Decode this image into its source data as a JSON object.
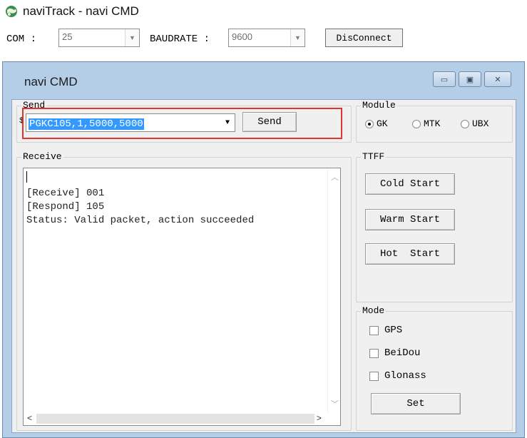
{
  "app": {
    "title": "naviTrack - navi CMD"
  },
  "toolbar": {
    "com_label": "COM :",
    "com_value": "25",
    "baud_label": "BAUDRATE :",
    "baud_value": "9600",
    "connect_button": "DisConnect"
  },
  "child_window": {
    "title": "navi CMD",
    "minimize_glyph": "▭",
    "maximize_glyph": "▣",
    "close_glyph": "✕"
  },
  "send": {
    "legend": "Send",
    "prefix": "$",
    "command": "PGKC105,1,5000,5000",
    "button": "Send"
  },
  "module": {
    "legend": "Module",
    "options": [
      {
        "label": "GK",
        "selected": true
      },
      {
        "label": "MTK",
        "selected": false
      },
      {
        "label": "UBX",
        "selected": false
      }
    ]
  },
  "receive": {
    "legend": "Receive",
    "lines": "\n[Receive] 001\n[Respond] 105\nStatus: Valid packet, action succeeded"
  },
  "ttff": {
    "legend": "TTFF",
    "cold": "Cold Start",
    "warm": "Warm Start",
    "hot": "Hot  Start"
  },
  "mode": {
    "legend": "Mode",
    "options": [
      {
        "label": "GPS",
        "checked": false
      },
      {
        "label": "BeiDou",
        "checked": false
      },
      {
        "label": "Glonass",
        "checked": false
      }
    ],
    "set_button": "Set"
  },
  "colors": {
    "highlight": "#e23232",
    "selection": "#3399ff",
    "frame": "#b3cee6"
  }
}
